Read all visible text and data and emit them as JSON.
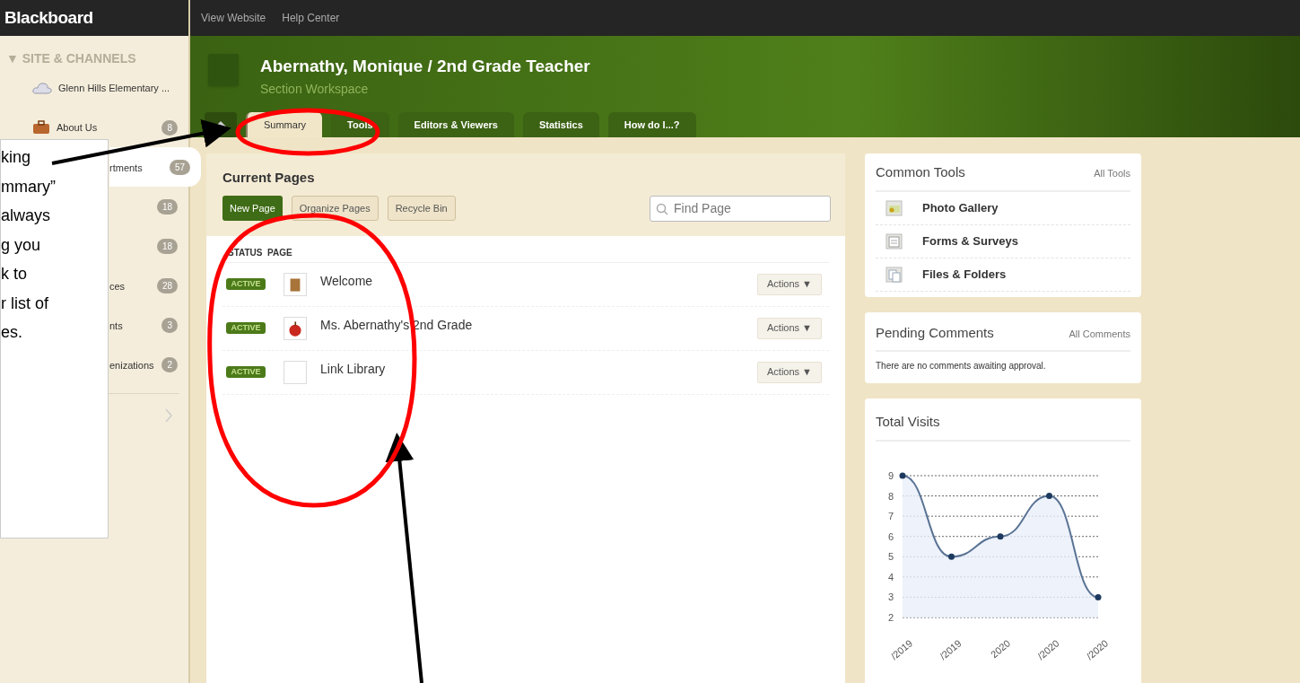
{
  "top_bar": {
    "logo": "Blackboard",
    "links": [
      "View Website",
      "Help Center"
    ]
  },
  "sidebar": {
    "heading": "▼ SITE & CHANNELS",
    "items": [
      {
        "kind": "full",
        "label": "Glenn Hills Elementary ...",
        "selected": false
      },
      {
        "kind": "full",
        "label": "About Us",
        "badge": "8",
        "selected": false
      },
      {
        "kind": "clipped",
        "label": "rtments",
        "badge": "57",
        "selected": true
      },
      {
        "kind": "clipped",
        "badge": "18",
        "selected": false
      },
      {
        "kind": "clipped",
        "badge": "18",
        "selected": false
      },
      {
        "kind": "clipped",
        "label": "ces",
        "badge": "28",
        "selected": false
      },
      {
        "kind": "clipped",
        "label": "nts",
        "badge": "3",
        "selected": false
      },
      {
        "kind": "clipped",
        "label": "enizations",
        "badge": "2",
        "selected": false
      }
    ]
  },
  "header": {
    "title": "Abernathy, Monique / 2nd Grade Teacher",
    "subtitle": "Section Workspace",
    "tabs": [
      {
        "label": "Summary",
        "selected": true
      },
      {
        "label": "Tools",
        "selected": false
      },
      {
        "label": "Editors & Viewers",
        "selected": false
      },
      {
        "label": "Statistics",
        "selected": false
      },
      {
        "label": "How do I...?",
        "selected": false
      }
    ]
  },
  "current_pages": {
    "title": "Current Pages",
    "buttons": [
      {
        "label": "New Page",
        "kind": "primary"
      },
      {
        "label": "Organize Pages",
        "kind": "secondary"
      },
      {
        "label": "Recycle Bin",
        "kind": "secondary"
      }
    ],
    "search": {
      "placeholder": "Find Page"
    },
    "columns": [
      "STATUS",
      "PAGE"
    ],
    "rows": [
      {
        "status": "ACTIVE",
        "page": "Welcome",
        "action": "Actions ▼"
      },
      {
        "status": "ACTIVE",
        "page": "Ms. Abernathy's 2nd Grade",
        "action": "Actions ▼"
      },
      {
        "status": "ACTIVE",
        "page": "Link Library",
        "action": "Actions ▼"
      }
    ]
  },
  "common_tools": {
    "title": "Common Tools",
    "link": "All Tools",
    "items": [
      {
        "label": "Photo Gallery"
      },
      {
        "label": "Forms & Surveys"
      },
      {
        "label": "Files & Folders"
      }
    ]
  },
  "pending_comments": {
    "title": "Pending Comments",
    "link": "All Comments",
    "message": "There are no comments awaiting approval."
  },
  "total_visits": {
    "title": "Total Visits",
    "chart_data": {
      "type": "area",
      "categories": [
        "/2019",
        "/2019",
        "2020",
        "/2020",
        "/2020"
      ],
      "series": [
        {
          "color": "#5a7394",
          "values": [
            9,
            5,
            6,
            8,
            3
          ]
        }
      ],
      "grid": true,
      "ylim": [
        2,
        9
      ],
      "yticks": [
        2,
        3,
        4,
        5,
        6,
        7,
        8,
        9
      ]
    }
  },
  "annotation": {
    "callout_lines": [
      "king",
      "mmary”",
      "always",
      "g you",
      "k to",
      "r list of",
      "es."
    ]
  }
}
